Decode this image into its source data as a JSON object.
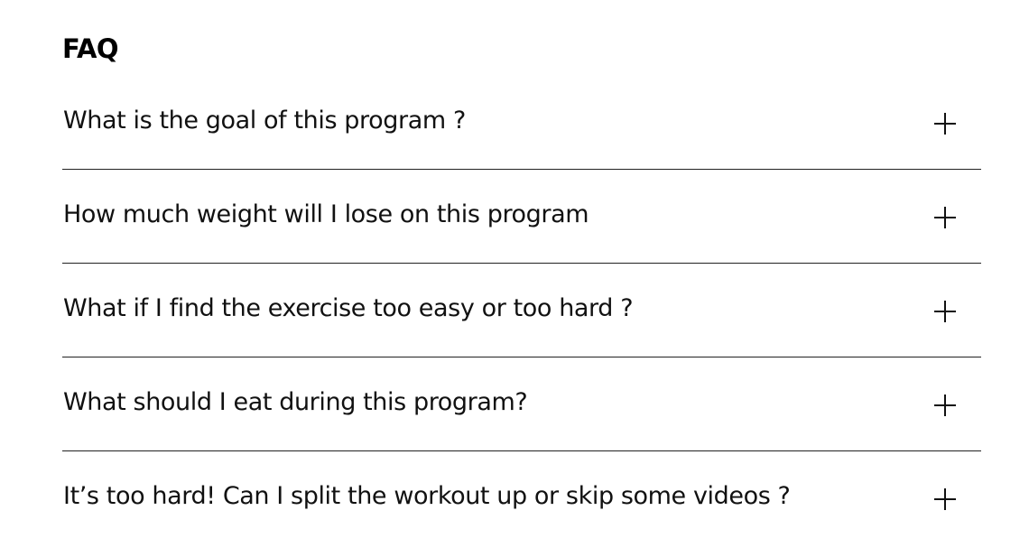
{
  "faq": {
    "title": "FAQ",
    "items": [
      {
        "question": "What is the goal of this program ?",
        "toggle_icon": "plus-icon"
      },
      {
        "question": "How much weight will I lose on this program",
        "toggle_icon": "plus-icon"
      },
      {
        "question": "What if I find the exercise too easy or too hard ?",
        "toggle_icon": "plus-icon"
      },
      {
        "question": "What should I eat during this program?",
        "toggle_icon": "plus-icon"
      },
      {
        "question": "It’s too hard! Can I split the workout up or skip some videos ?",
        "toggle_icon": "plus-icon"
      }
    ]
  },
  "colors": {
    "background": "#ffffff",
    "text": "#111111",
    "divider": "#222222"
  }
}
